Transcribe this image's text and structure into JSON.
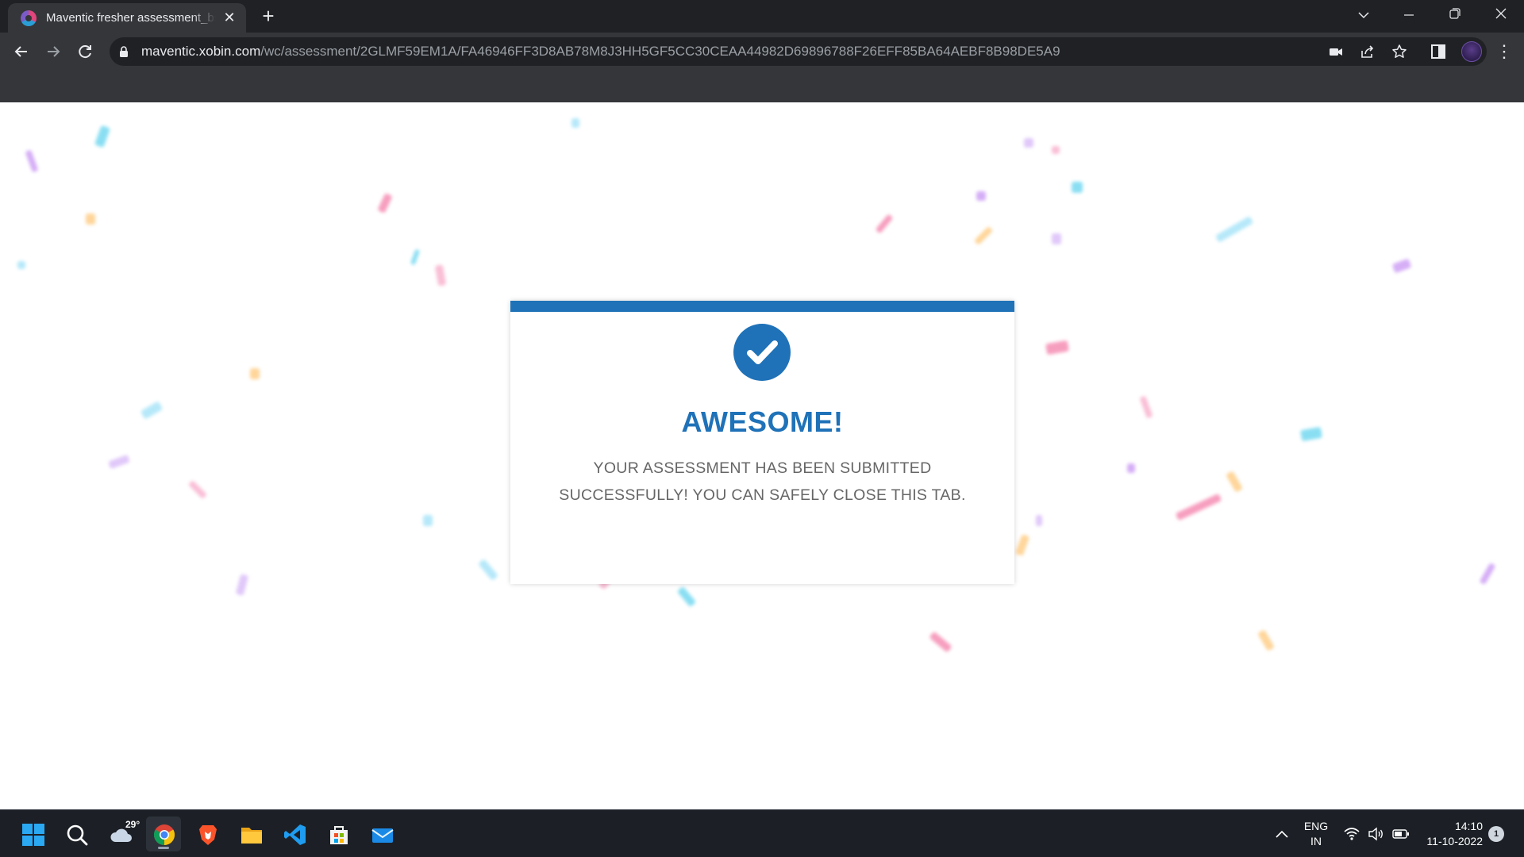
{
  "browser": {
    "tab_title": "Maventic fresher assessment_bsjt",
    "url_host": "maventic.xobin.com",
    "url_path": "/wc/assessment/2GLMF59EM1A/FA46946FF3D8AB78M8J3HH5GF5CC30CEAA44982D69896788F26EFF85BA64AEBF8B98DE5A9"
  },
  "card": {
    "title": "AWESOME!",
    "message_line1": "YOUR ASSESSMENT HAS BEEN SUBMITTED",
    "message_line2": "SUCCESSFULLY! YOU CAN SAFELY CLOSE THIS TAB.",
    "accent_color": "#1f72b8"
  },
  "taskbar": {
    "weather_temp": "29°",
    "language_line1": "ENG",
    "language_line2": "IN",
    "time": "14:10",
    "date": "11-10-2022",
    "notification_count": "1"
  }
}
